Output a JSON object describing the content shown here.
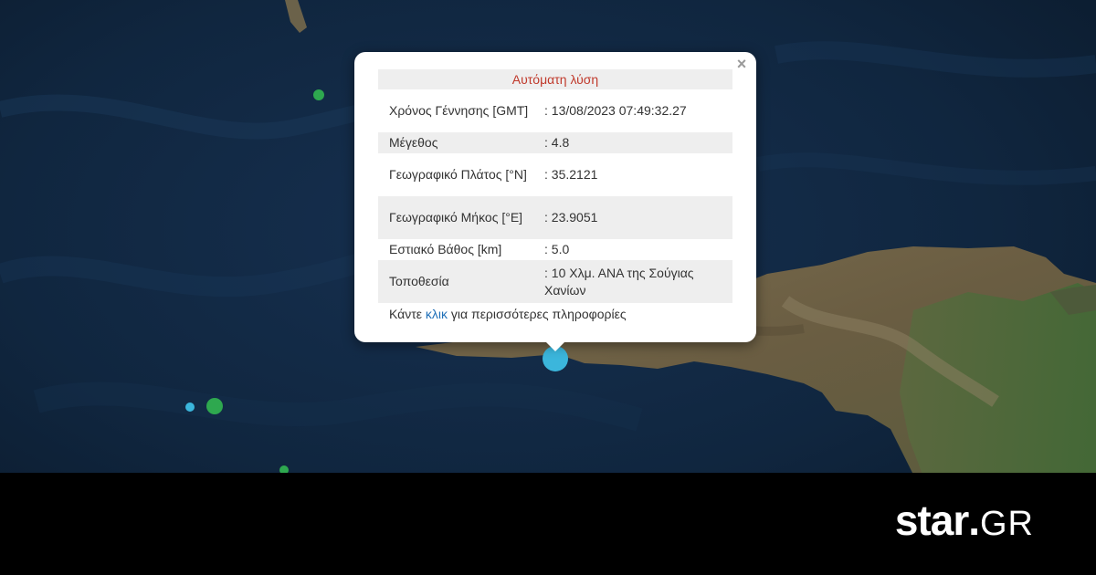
{
  "popup": {
    "title": "Αυτόματη λύση",
    "close_label": "×",
    "rows": [
      {
        "label": "Χρόνος Γέννησης [GMT]",
        "value": ": 13/08/2023 07:49:32.27"
      },
      {
        "label": "Μέγεθος",
        "value": ": 4.8"
      },
      {
        "label": "Γεωγραφικό Πλάτος [°N]",
        "value": ": 35.2121"
      },
      {
        "label": "Γεωγραφικό Μήκος [°E]",
        "value": ": 23.9051"
      },
      {
        "label": "Εστιακό Βάθος [km]",
        "value": ": 5.0"
      },
      {
        "label": "Τοποθεσία",
        "value": ": 10 Χλμ. ΑΝΑ της Σούγιας Χανίων"
      }
    ],
    "footer_prefix": "Κάντε ",
    "footer_link": "κλικ",
    "footer_suffix": " για περισσότερες πληροφορίες"
  },
  "brand": {
    "part1": "star",
    "separator": ".",
    "part2": "GR"
  },
  "colors": {
    "sea": "#0f2338",
    "land": "#6b6148",
    "land_green": "#4c6b3a",
    "selected_marker": "#3bb6dc",
    "marker_green": "#2ea84f",
    "header_text": "#c0392b",
    "link": "#1f6fb8"
  }
}
